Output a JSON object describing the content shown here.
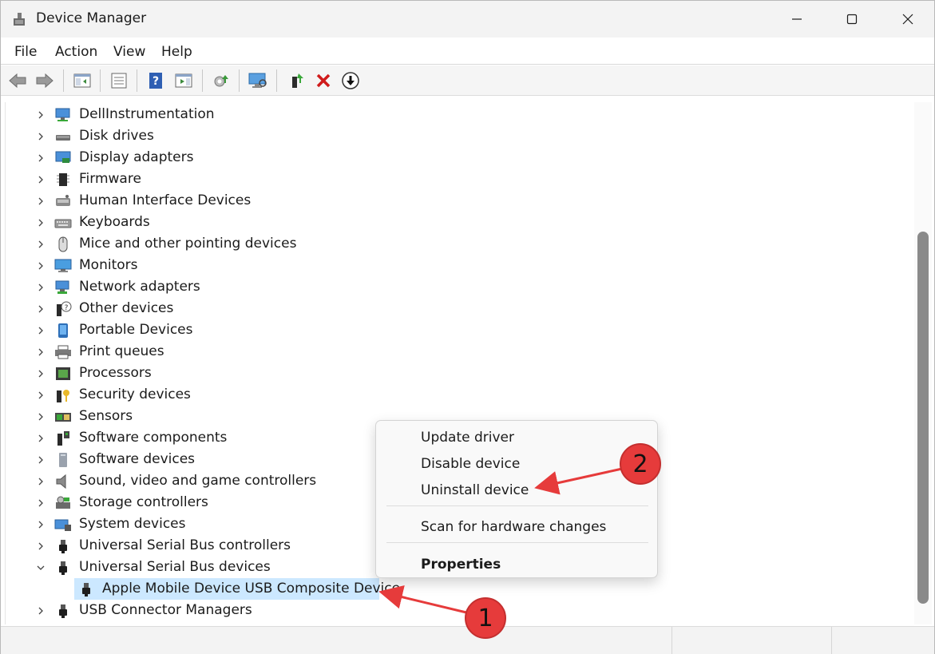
{
  "window": {
    "title": "Device Manager"
  },
  "menu": [
    "File",
    "Action",
    "View",
    "Help"
  ],
  "tree": {
    "items": [
      {
        "label": "DellInstrumentation",
        "icon": "monitor-network-icon"
      },
      {
        "label": "Disk drives",
        "icon": "disk-drive-icon"
      },
      {
        "label": "Display adapters",
        "icon": "display-adapter-icon"
      },
      {
        "label": "Firmware",
        "icon": "chip-icon"
      },
      {
        "label": "Human Interface Devices",
        "icon": "hid-icon"
      },
      {
        "label": "Keyboards",
        "icon": "keyboard-icon"
      },
      {
        "label": "Mice and other pointing devices",
        "icon": "mouse-icon"
      },
      {
        "label": "Monitors",
        "icon": "monitor-icon"
      },
      {
        "label": "Network adapters",
        "icon": "network-icon"
      },
      {
        "label": "Other devices",
        "icon": "unknown-device-icon"
      },
      {
        "label": "Portable Devices",
        "icon": "portable-device-icon"
      },
      {
        "label": "Print queues",
        "icon": "printer-icon"
      },
      {
        "label": "Processors",
        "icon": "processor-icon"
      },
      {
        "label": "Security devices",
        "icon": "security-key-icon"
      },
      {
        "label": "Sensors",
        "icon": "sensor-icon"
      },
      {
        "label": "Software components",
        "icon": "software-component-icon"
      },
      {
        "label": "Software devices",
        "icon": "software-device-icon"
      },
      {
        "label": "Sound, video and game controllers",
        "icon": "speaker-icon"
      },
      {
        "label": "Storage controllers",
        "icon": "storage-controller-icon"
      },
      {
        "label": "System devices",
        "icon": "system-device-icon"
      },
      {
        "label": "Universal Serial Bus controllers",
        "icon": "usb-icon"
      },
      {
        "label": "Universal Serial Bus devices",
        "icon": "usb-icon",
        "expanded": true
      },
      {
        "label": "Apple Mobile Device USB Composite Device",
        "icon": "usb-icon",
        "child": true,
        "selected": true
      },
      {
        "label": "USB Connector Managers",
        "icon": "usb-icon"
      }
    ]
  },
  "context_menu": {
    "items": [
      "Update driver",
      "Disable device",
      "Uninstall device",
      "Scan for hardware changes",
      "Properties"
    ]
  },
  "annotations": {
    "badge_1": "1",
    "badge_2": "2",
    "color": "#e63b3b"
  }
}
